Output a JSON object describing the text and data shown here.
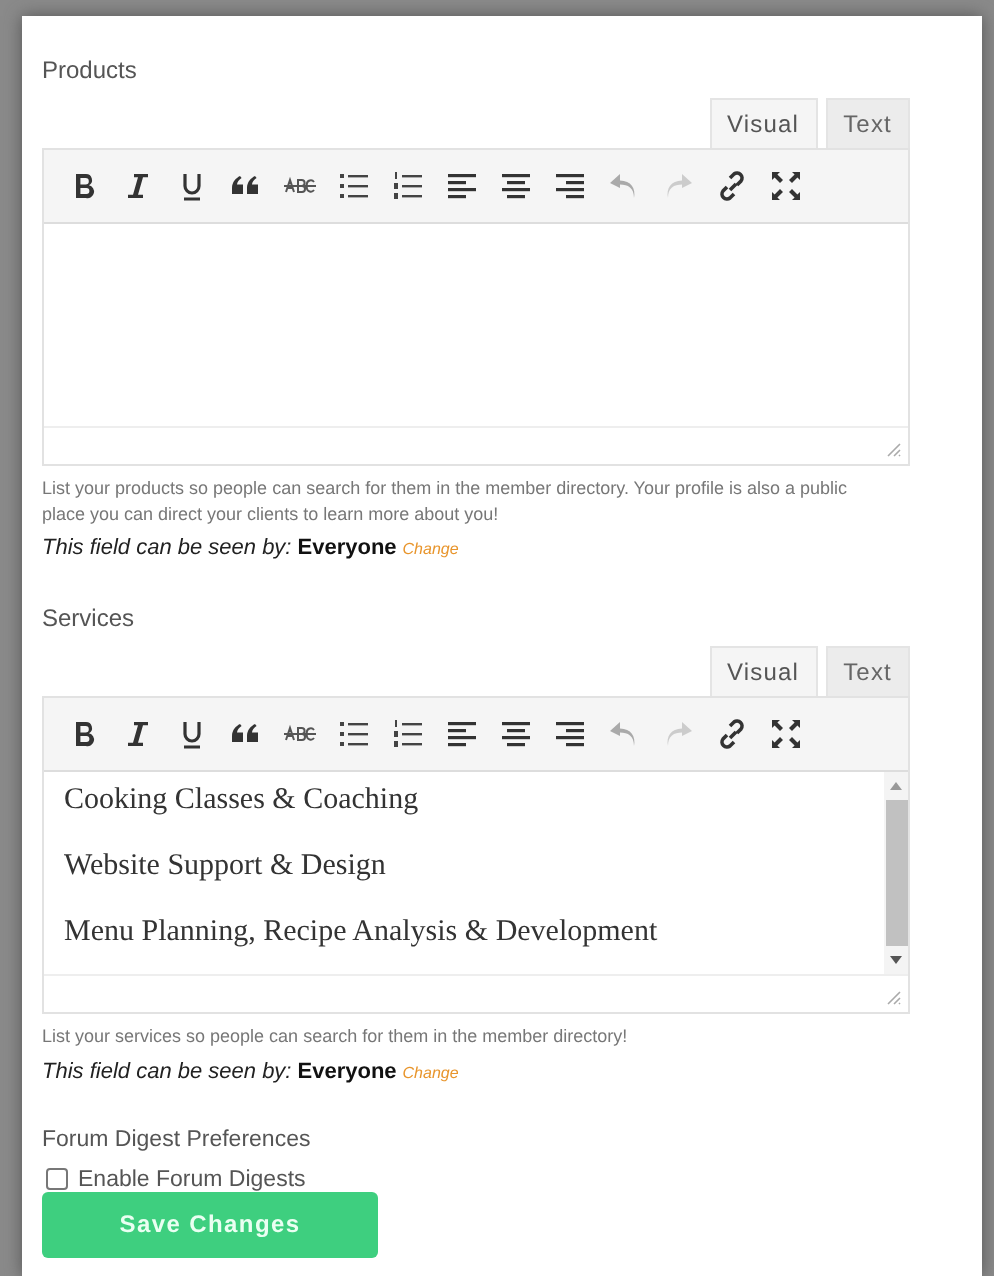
{
  "fields": [
    {
      "label": "Products",
      "tabs": [
        {
          "label": "Visual",
          "selected": true
        },
        {
          "label": "Text",
          "selected": false
        }
      ],
      "help": "List your products so people can search for them in the member directory. Your profile is also a public place you can direct your clients to learn more about you!",
      "visibility_label": "This field can be seen by:",
      "visibility": "Everyone",
      "change": "Change"
    },
    {
      "label": "Services",
      "tabs": [
        {
          "label": "Visual",
          "selected": true
        },
        {
          "label": "Text",
          "selected": false
        }
      ],
      "paragraphs": [
        "Cooking Classes & Coaching",
        "Website Support & Design",
        "Menu Planning, Recipe Analysis & Development"
      ],
      "scrollable": true,
      "help": "List your services so people can search for them in the member directory!",
      "visibility_label": "This field can be seen by:",
      "visibility": "Everyone",
      "change": "Change"
    }
  ],
  "forum": {
    "heading": "Forum Digest Preferences",
    "checkbox": {
      "label": "Enable Forum Digests",
      "checked": false
    }
  },
  "save_button": "Save Changes"
}
